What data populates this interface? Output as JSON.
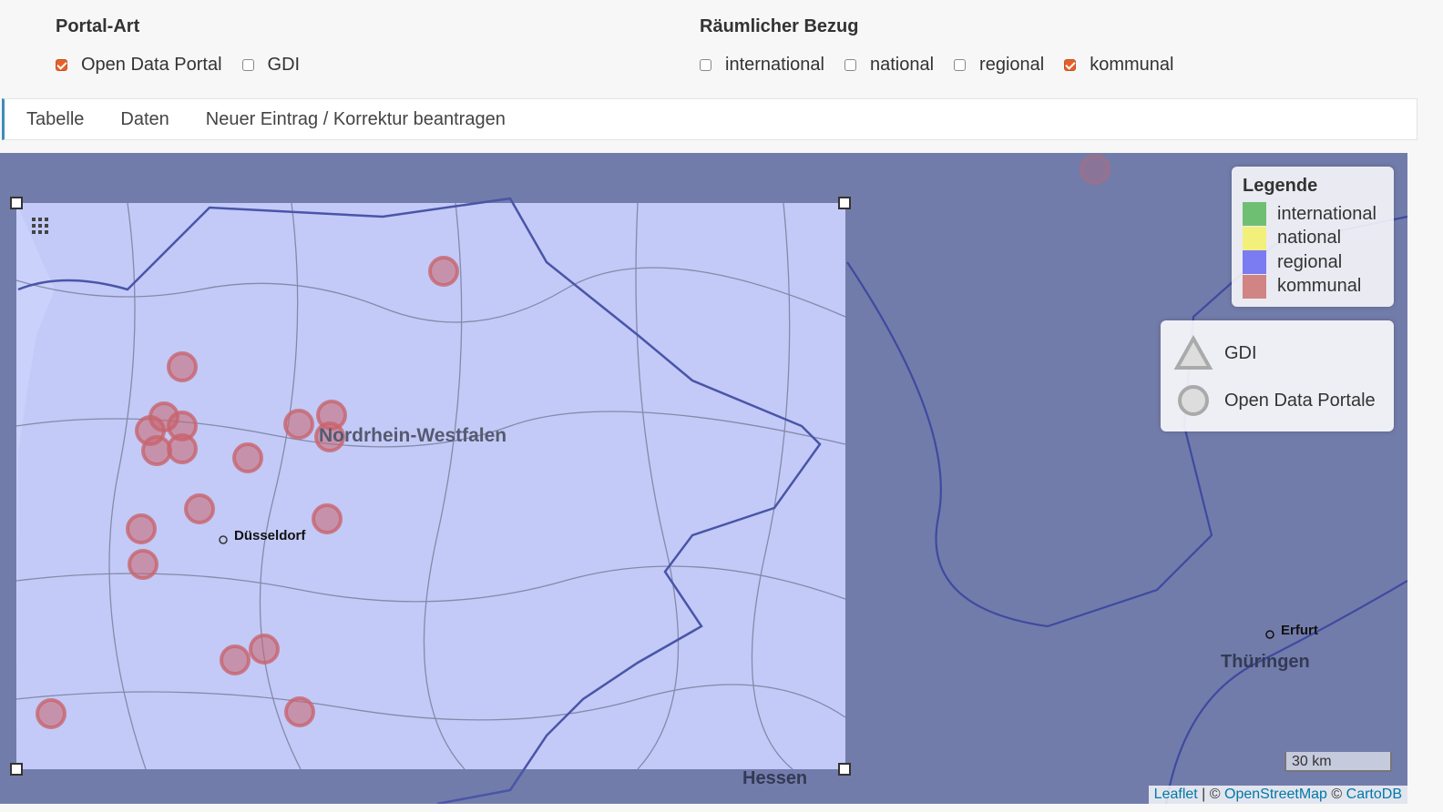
{
  "filters": {
    "portal_art": {
      "title": "Portal-Art",
      "options": [
        {
          "label": "Open Data Portal",
          "checked": true
        },
        {
          "label": "GDI",
          "checked": false
        }
      ]
    },
    "raeumlicher_bezug": {
      "title": "Räumlicher Bezug",
      "options": [
        {
          "label": "international",
          "checked": false
        },
        {
          "label": "national",
          "checked": false
        },
        {
          "label": "regional",
          "checked": false
        },
        {
          "label": "kommunal",
          "checked": true
        }
      ]
    }
  },
  "tabs": [
    {
      "label": "Tabelle"
    },
    {
      "label": "Daten"
    },
    {
      "label": "Neuer Eintrag / Korrektur beantragen"
    }
  ],
  "map": {
    "place_labels": {
      "nrw": "Nordrhein-Westfalen",
      "duesseldorf": "Düsseldorf",
      "hessen": "Hessen",
      "erfurt": "Erfurt",
      "thueringen": "Thüringen"
    },
    "legend": {
      "title": "Legende",
      "items": [
        {
          "label": "international",
          "color": "#6fbf73"
        },
        {
          "label": "national",
          "color": "#f2f07a"
        },
        {
          "label": "regional",
          "color": "#7b7bf2"
        },
        {
          "label": "kommunal",
          "color": "#d08484"
        }
      ]
    },
    "type_legend": {
      "items": [
        {
          "label": "GDI",
          "icon": "triangle-icon"
        },
        {
          "label": "Open Data Portale",
          "icon": "circle-icon"
        }
      ]
    },
    "scale": "30 km",
    "attribution": {
      "leaflet": "Leaflet",
      "sep1": " | © ",
      "osm": "OpenStreetMap",
      "sep2": " © ",
      "carto": "CartoDB"
    },
    "colors": {
      "overlay": "#5e6aa0",
      "selection": "#c7cffb",
      "marker": "#c8646e"
    }
  }
}
